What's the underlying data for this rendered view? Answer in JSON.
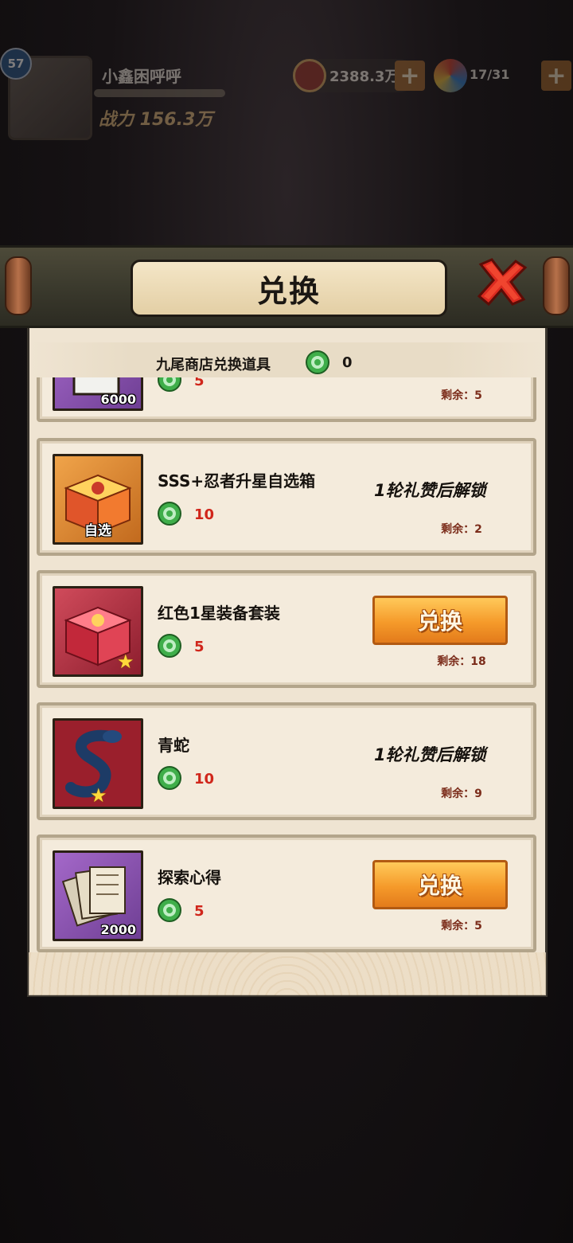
{
  "hud": {
    "level": "57",
    "player_name": "小鑫困呼呼",
    "power": "战力 156.3万",
    "coins": "2388.3万",
    "stamina": "17/31",
    "plus_symbol": "+"
  },
  "modal": {
    "title": "兑换",
    "currency_label": "九尾商店兑换道具",
    "currency_count": "0"
  },
  "colors": {
    "accent_orange": "#f59a2a",
    "price_red": "#d0261b",
    "remain_brown": "#7b2c1a",
    "jade_green": "#3fae4a"
  },
  "items": [
    {
      "name": "",
      "count_badge": "6000",
      "price": "5",
      "remaining": "剩余：5",
      "action": "button",
      "icon": "book-icon"
    },
    {
      "name": "SSS+忍者升星自选箱",
      "tag": "自选",
      "price": "10",
      "remaining": "剩余：2",
      "action": "locked",
      "lock_text": "1轮礼赞后解锁",
      "icon": "gift-box-icon"
    },
    {
      "name": "红色1星装备套装",
      "price": "5",
      "remaining": "剩余：18",
      "action": "button",
      "button_label": "兑换",
      "icon": "gift-box-icon"
    },
    {
      "name": "青蛇",
      "price": "10",
      "remaining": "剩余：9",
      "action": "locked",
      "lock_text": "1轮礼赞后解锁",
      "icon": "snake-icon"
    },
    {
      "name": "探索心得",
      "count_badge": "2000",
      "price": "5",
      "remaining": "剩余：5",
      "action": "button",
      "button_label": "兑换",
      "icon": "scroll-notes-icon"
    }
  ]
}
